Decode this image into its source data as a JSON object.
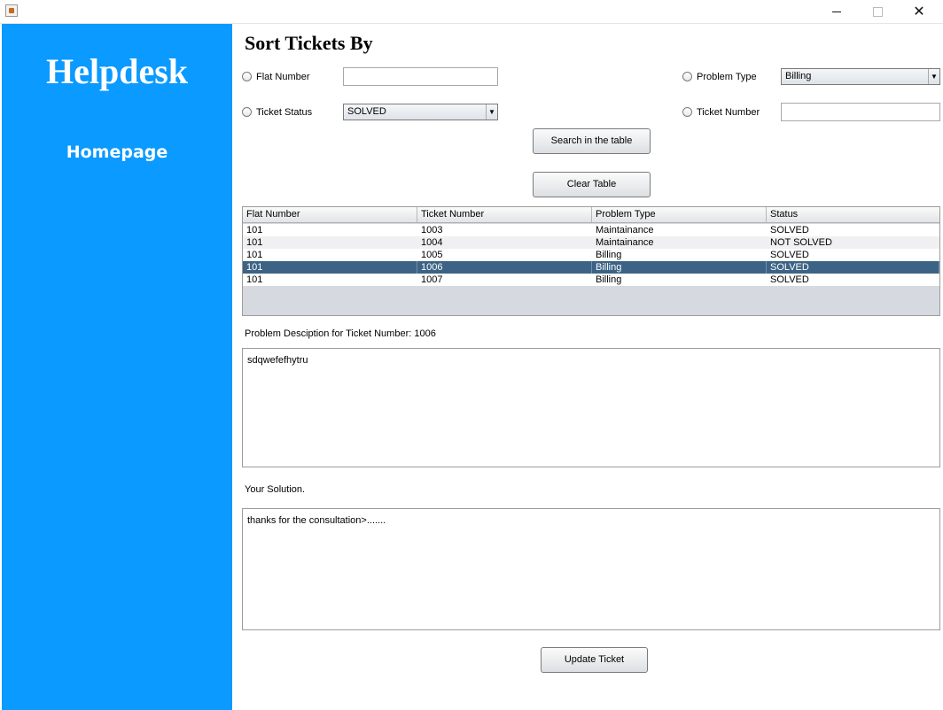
{
  "window": {
    "minimize_glyph": "",
    "maximize_glyph": "",
    "close_glyph": "✕"
  },
  "sidebar": {
    "brand": "Helpdesk",
    "home_link": "Homepage"
  },
  "filters": {
    "heading": "Sort Tickets By",
    "flat_number_label": "Flat Number",
    "flat_number_value": "",
    "problem_type_label": "Problem Type",
    "problem_type_value": "Billing",
    "ticket_status_label": "Ticket Status",
    "ticket_status_value": "SOLVED",
    "ticket_number_label": "Ticket Number",
    "ticket_number_value": "",
    "dropdown_arrow": "▼"
  },
  "buttons": {
    "search": "Search in the table",
    "clear": "Clear Table",
    "update": "Update Ticket"
  },
  "table": {
    "columns": [
      "Flat Number",
      "Ticket Number",
      "Problem Type",
      "Status"
    ],
    "rows": [
      [
        "101",
        "1003",
        "Maintainance",
        "SOLVED"
      ],
      [
        "101",
        "1004",
        "Maintainance",
        "NOT SOLVED"
      ],
      [
        "101",
        "1005",
        "Billing",
        "SOLVED"
      ],
      [
        "101",
        "1006",
        "Billing",
        "SOLVED"
      ],
      [
        "101",
        "1007",
        "Billing",
        "SOLVED"
      ]
    ],
    "selected_row": 3
  },
  "details": {
    "description_caption": "Problem Desciption for Ticket Number: 1006",
    "description_text": "sdqwefefhytru",
    "solution_caption": "Your Solution.",
    "solution_text": "thanks for the consultation>......."
  },
  "colors": {
    "sidebar": "#0b9aff",
    "selected_row": "#3c6385"
  }
}
